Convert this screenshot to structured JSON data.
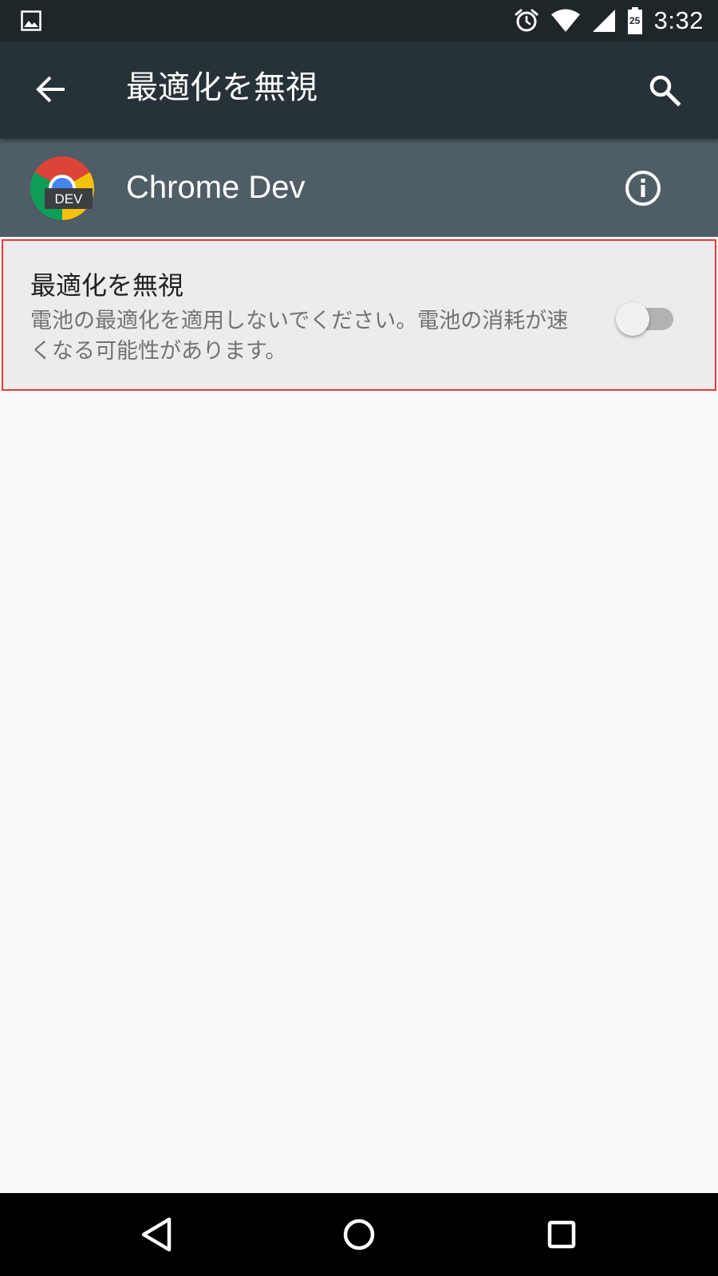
{
  "status_bar": {
    "time": "3:32",
    "battery_level": "25",
    "icons": [
      "image-notification-icon",
      "alarm-icon",
      "wifi-icon",
      "cell-signal-icon",
      "battery-icon"
    ]
  },
  "app_bar": {
    "title": "最適化を無視",
    "back_icon": "arrow-back-icon",
    "search_icon": "search-icon"
  },
  "app_header": {
    "app_name": "Chrome Dev",
    "badge": "DEV",
    "info_icon": "info-icon"
  },
  "preference": {
    "title": "最適化を無視",
    "summary": "電池の最適化を適用しないでください。電池の消耗が速くなる可能性があります。",
    "switch_on": false
  },
  "colors": {
    "status_bar": "#1f2629",
    "app_bar": "#263238",
    "app_header": "#4f5d66",
    "highlight_border": "#e53a3a",
    "row_background": "#ececec",
    "page_background": "#fafafa"
  },
  "nav_bar": {
    "icons": [
      "back-triangle-icon",
      "home-circle-icon",
      "recents-square-icon"
    ]
  }
}
